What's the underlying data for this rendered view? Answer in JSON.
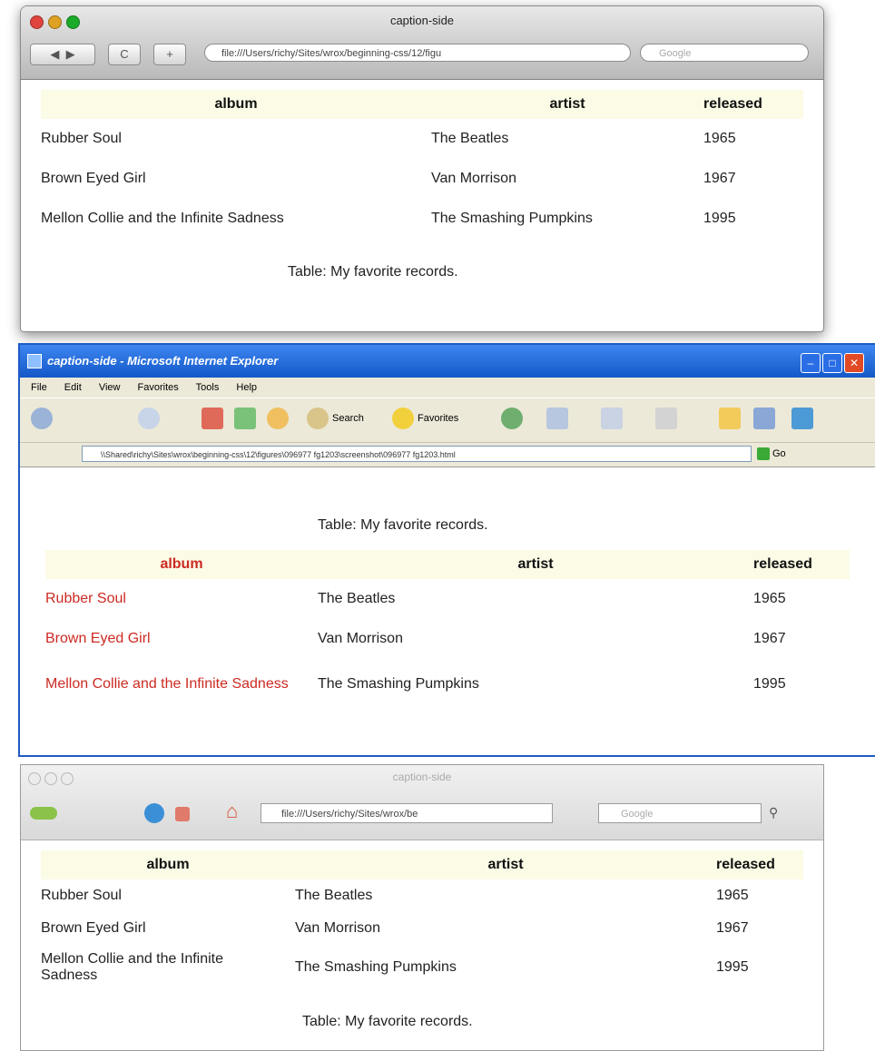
{
  "safari": {
    "title": "caption-side",
    "url": "file:///Users/richy/Sites/wrox/beginning-css/12/figu",
    "search_placeholder": "Google",
    "reload_label": "C",
    "add_label": "+",
    "table": {
      "headers": [
        "album",
        "artist",
        "released"
      ],
      "rows": [
        [
          "Rubber Soul",
          "The Beatles",
          "1965"
        ],
        [
          "Brown Eyed Girl",
          "Van Morrison",
          "1967"
        ],
        [
          "Mellon Collie and the Infinite Sadness",
          "The Smashing Pumpkins",
          "1995"
        ]
      ],
      "caption": "Table: My favorite records."
    }
  },
  "ie": {
    "title": "caption-side - Microsoft Internet Explorer",
    "menu": [
      "File",
      "Edit",
      "View",
      "Favorites",
      "Tools",
      "Help"
    ],
    "toolbar": {
      "search_label": "Search",
      "favorites_label": "Favorites"
    },
    "address": "\\\\Shared\\richy\\Sites\\wrox\\beginning-css\\12\\figures\\096977 fg1203\\screenshot\\096977 fg1203.html",
    "go_label": "Go",
    "table": {
      "caption": "Table: My favorite records.",
      "headers": [
        "album",
        "artist",
        "released"
      ],
      "rows": [
        [
          "Rubber Soul",
          "The Beatles",
          "1965"
        ],
        [
          "Brown Eyed Girl",
          "Van Morrison",
          "1967"
        ],
        [
          "Mellon Collie and the Infinite Sadness",
          "The Smashing Pumpkins",
          "1995"
        ]
      ]
    },
    "colors": {
      "accent_red": "#cc2a22",
      "titlebar_blue": "#1458c8"
    }
  },
  "firefox": {
    "title": "caption-side",
    "url": "file:///Users/richy/Sites/wrox/be",
    "search_placeholder": "Google",
    "table": {
      "headers": [
        "album",
        "artist",
        "released"
      ],
      "rows": [
        [
          "Rubber Soul",
          "The Beatles",
          "1965"
        ],
        [
          "Brown Eyed Girl",
          "Van Morrison",
          "1967"
        ],
        [
          "Mellon Collie and the Infinite Sadness",
          "The Smashing Pumpkins",
          "1995"
        ]
      ],
      "caption": "Table: My favorite records."
    }
  }
}
